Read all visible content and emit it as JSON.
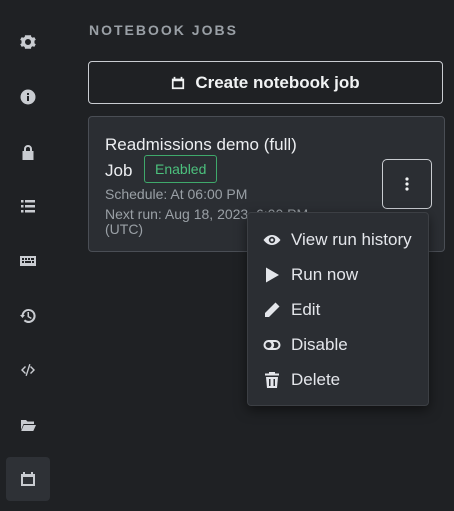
{
  "sidebar": {
    "items": [
      {
        "icon": "gear-icon"
      },
      {
        "icon": "info-icon"
      },
      {
        "icon": "lock-icon"
      },
      {
        "icon": "list-icon"
      },
      {
        "icon": "keyboard-icon"
      },
      {
        "icon": "history-icon"
      },
      {
        "icon": "code-icon"
      },
      {
        "icon": "folder-open-icon"
      },
      {
        "icon": "calendar-icon",
        "active": true
      }
    ]
  },
  "section": {
    "title": "NOTEBOOK JOBS"
  },
  "create_button": {
    "label": "Create notebook job",
    "icon": "calendar-icon"
  },
  "job": {
    "title": "Readmissions demo (full)",
    "title_suffix": "Job",
    "status": "Enabled",
    "status_color": "#4cc07d",
    "schedule": "Schedule: At 06:00 PM",
    "next_run": "Next run: Aug 18, 2023, 6:00 PM",
    "timezone": "(UTC)"
  },
  "menu": {
    "items": [
      {
        "label": "View run history",
        "icon": "eye-icon"
      },
      {
        "label": "Run now",
        "icon": "play-icon"
      },
      {
        "label": "Edit",
        "icon": "pencil-icon"
      },
      {
        "label": "Disable",
        "icon": "toggle-off-icon"
      },
      {
        "label": "Delete",
        "icon": "trash-icon"
      }
    ]
  },
  "colors": {
    "background": "#1f2124",
    "card": "#2b2e33",
    "accent_green": "#4cc07d"
  }
}
